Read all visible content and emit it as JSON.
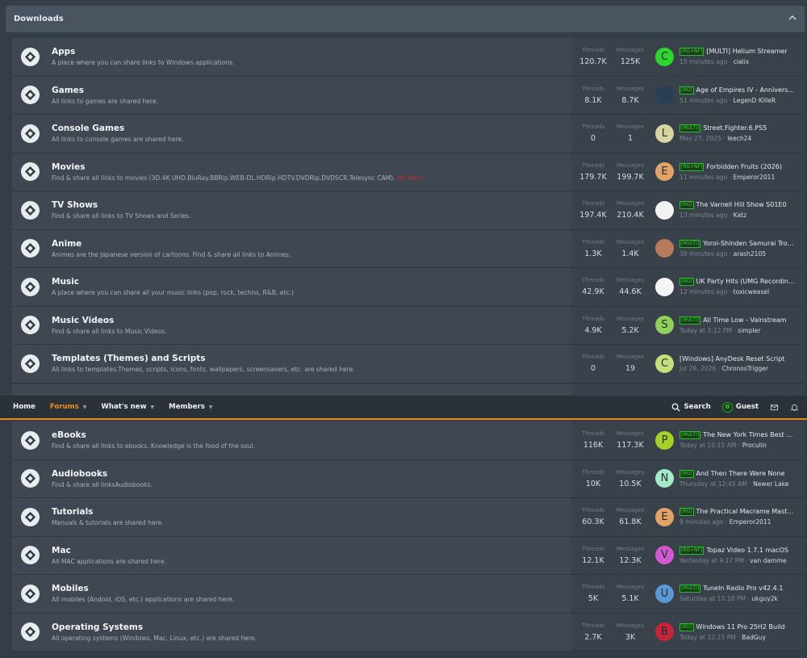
{
  "section": {
    "title": "Downloads"
  },
  "labels": {
    "threads": "Threads",
    "messages": "Messages"
  },
  "nav": {
    "home": "Home",
    "forums": "Forums",
    "whats_new": "What's new",
    "members": "Members",
    "search": "Search",
    "guest_count": "0",
    "guest": "Guest"
  },
  "forums_top": [
    {
      "title": "Apps",
      "desc": "A place where you can share links to Windows applications.",
      "threads": "120.7K",
      "messages": "125K",
      "avatar": {
        "letter": "C",
        "color": "#2ed52e"
      },
      "prefix": "[RG+NF]",
      "latest": "[MULTI] Helium Streamer",
      "time": "15 minutes ago",
      "user": "cialix"
    },
    {
      "title": "Games",
      "desc": "All links to games are shared here.",
      "threads": "8.1K",
      "messages": "8.7K",
      "avatar": {
        "letter": "",
        "color": "#2a3f57"
      },
      "prefix": "[RG]",
      "latest": "Age of Empires IV - Anniversary",
      "time": "51 minutes ago",
      "user": "LegenD KilleR"
    },
    {
      "title": "Console Games",
      "desc": "All links to console games are shared here.",
      "threads": "0",
      "messages": "1",
      "avatar": {
        "letter": "L",
        "color": "#d8d5a0"
      },
      "prefix": "[MULTI]",
      "latest": "Street.Fighter.6.PS5",
      "time": "May 27, 2025",
      "user": "leech24"
    },
    {
      "title": "Movies",
      "desc": "Find & share all links to movies (3D.4K UHD.BluRay.BBRip.WEB-DL.HDRip.HDTV.DVDRip.DVDSCR.Telesync CAM).",
      "desc_extra": "No Porn!",
      "threads": "179.7K",
      "messages": "199.7K",
      "avatar": {
        "letter": "E",
        "color": "#e3a268"
      },
      "prefix": "[RG+NF]",
      "latest": "Forbidden Fruits (2026)",
      "time": "11 minutes ago",
      "user": "Emperor2011"
    },
    {
      "title": "TV Shows",
      "desc": "Find & share all links to TV Shows and Series.",
      "threads": "197.4K",
      "messages": "210.4K",
      "avatar": {
        "letter": "",
        "color": "#f2f2f2"
      },
      "prefix": "[RG]",
      "latest": "The Varnell Hill Show S01E0",
      "time": "13 minutes ago",
      "user": "Katz"
    },
    {
      "title": "Anime",
      "desc": "Animes are the Japanese version of cartoons. Find & share all links to Animes.",
      "threads": "1.3K",
      "messages": "1.4K",
      "avatar": {
        "letter": "",
        "color": "#b77a5a"
      },
      "prefix": "[MULTI]",
      "latest": "Yoroi-Shinden Samurai Troopers",
      "time": "38 minutes ago",
      "user": "arash2105"
    },
    {
      "title": "Music",
      "desc": "A place where you can share all your music links (pop, rock, techno, R&B, etc.)",
      "threads": "42.9K",
      "messages": "44.6K",
      "avatar": {
        "letter": "",
        "color": "#f5f5f5"
      },
      "prefix": "[RG]",
      "latest": "UK Party Hits (UMG Recordings)",
      "time": "12 minutes ago",
      "user": "toxicweasel"
    },
    {
      "title": "Music Videos",
      "desc": "Find & share all links to Music Videos.",
      "threads": "4.9K",
      "messages": "5.2K",
      "avatar": {
        "letter": "S",
        "color": "#8fd15a"
      },
      "prefix": "[MULTI]",
      "latest": "All Time Low - Vainstream",
      "time": "Today at 3:12 PM",
      "user": "simpler"
    },
    {
      "title": "Templates (Themes) and Scripts",
      "desc": "All links to templates.Themes, scripts, icons, fonts, wallpapers, screensavers, etc. are shared here.",
      "threads": "0",
      "messages": "19",
      "avatar": {
        "letter": "C",
        "color": "#c3e07a"
      },
      "prefix": "",
      "latest": "[Windows] AnyDesk Reset Script",
      "time": "Jul 29, 2026",
      "user": "ChronosTrigger"
    }
  ],
  "forums_bottom": [
    {
      "title": "eBooks",
      "desc": "Find & share all links to ebooks. Knowledge is the food of the soul.",
      "threads": "116K",
      "messages": "117.3K",
      "avatar": {
        "letter": "P",
        "color": "#a7d12a"
      },
      "prefix": "[MULTI]",
      "latest": "The New York Times Best Sellers",
      "time": "Today at 10:15 AM",
      "user": "Proculin"
    },
    {
      "title": "Audiobooks",
      "desc": "Find & share all linksAudiobooks.",
      "threads": "10K",
      "messages": "10.5K",
      "avatar": {
        "letter": "N",
        "color": "#a6e9c9"
      },
      "prefix": "[RG]",
      "latest": "And Then There Were None",
      "time": "Thursday at 12:45 AM",
      "user": "Newer Lake"
    },
    {
      "title": "Tutorials",
      "desc": "Manuals & tutorials are shared here.",
      "threads": "60.3K",
      "messages": "61.8K",
      "avatar": {
        "letter": "E",
        "color": "#e3a268"
      },
      "prefix": "[RG]",
      "latest": "The Practical Macrame Masterclass",
      "time": "9 minutes ago",
      "user": "Emperor2011"
    },
    {
      "title": "Mac",
      "desc": "All MAC applications are shared here.",
      "threads": "12.1K",
      "messages": "12.3K",
      "avatar": {
        "letter": "V",
        "color": "#d15ad1"
      },
      "prefix": "[RG+NF]",
      "latest": "Topaz Video 1.7.1 macOS",
      "time": "Yesterday at 9:17 PM",
      "user": "van damme"
    },
    {
      "title": "Mobiles",
      "desc": "All mobiles (Andoid, iOS, etc.) applications are shared here.",
      "threads": "5K",
      "messages": "5.1K",
      "avatar": {
        "letter": "U",
        "color": "#5a98d6"
      },
      "prefix": "[MULTI]",
      "latest": "TuneIn Radio Pro v42.4.1",
      "time": "Saturday at 11:18 PM",
      "user": "ukguy2k"
    },
    {
      "title": "Operating Systems",
      "desc": "All operating systems (Windows, Mac, Linux, etc.) are shared here.",
      "threads": "2.7K",
      "messages": "3K",
      "avatar": {
        "letter": "B",
        "color": "#c5253a"
      },
      "prefix": "[RG]",
      "latest": "Windows 11 Pro 25H2 Build",
      "time": "Today at 12:15 PM",
      "user": "BadGuy"
    }
  ]
}
